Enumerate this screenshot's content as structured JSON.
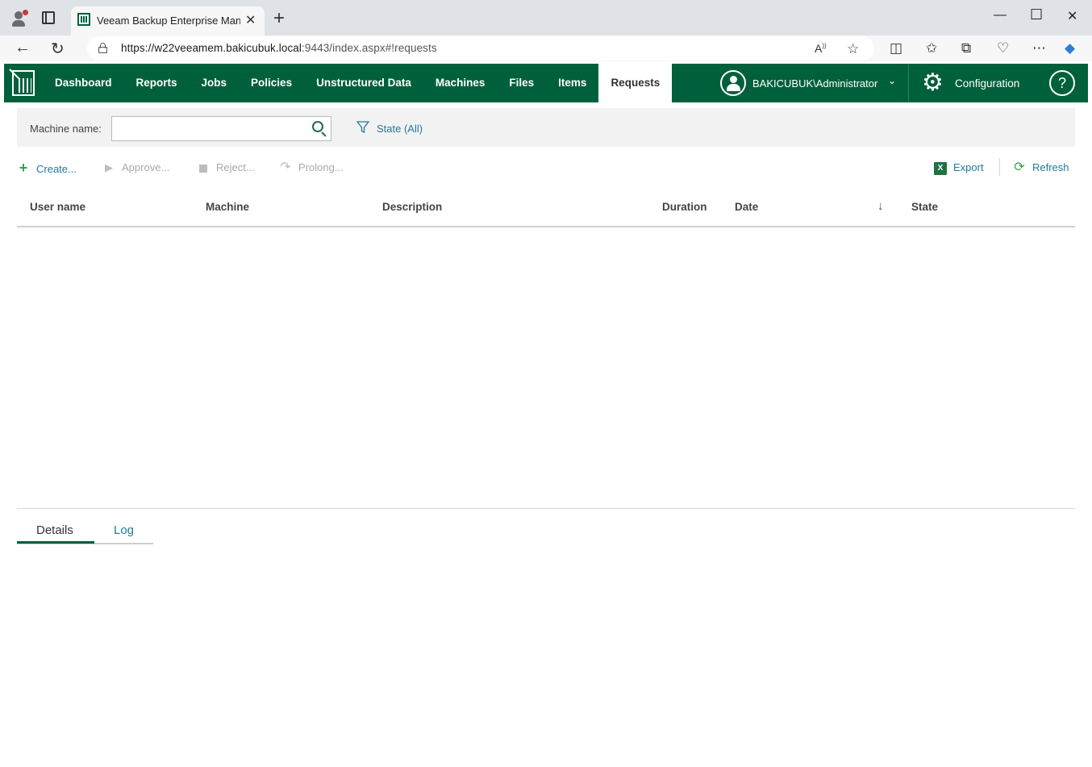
{
  "browser": {
    "tab_title": "Veeam Backup Enterprise Manager",
    "url_host": "https://w22veeamem.bakicubuk.local",
    "url_rest": ":9443/index.aspx#!requests",
    "new_tab_icon": "plus-icon",
    "window_controls": {
      "minimize": "—",
      "maximize": "☐",
      "close": "✕"
    }
  },
  "app": {
    "brand_color": "#00603c",
    "nav": [
      {
        "label": "Dashboard"
      },
      {
        "label": "Reports"
      },
      {
        "label": "Jobs"
      },
      {
        "label": "Policies"
      },
      {
        "label": "Unstructured Data"
      },
      {
        "label": "Machines"
      },
      {
        "label": "Files"
      },
      {
        "label": "Items"
      },
      {
        "label": "Requests",
        "active": true
      }
    ],
    "user": "BAKICUBUK\\Administrator",
    "configuration": "Configuration",
    "help": "?"
  },
  "filter": {
    "machine_name_label": "Machine name:",
    "machine_name_value": "",
    "state_filter": "State (All)"
  },
  "actions": {
    "create": "Create...",
    "approve": "Approve...",
    "reject": "Reject...",
    "prolong": "Prolong...",
    "export": "Export",
    "refresh": "Refresh"
  },
  "grid": {
    "columns": [
      "User name",
      "Machine",
      "Description",
      "Duration",
      "Date",
      "State"
    ],
    "sorted_column": "Date",
    "sort_direction": "descending",
    "rows": []
  },
  "detail_tabs": {
    "details": "Details",
    "log": "Log",
    "active": "Details"
  }
}
